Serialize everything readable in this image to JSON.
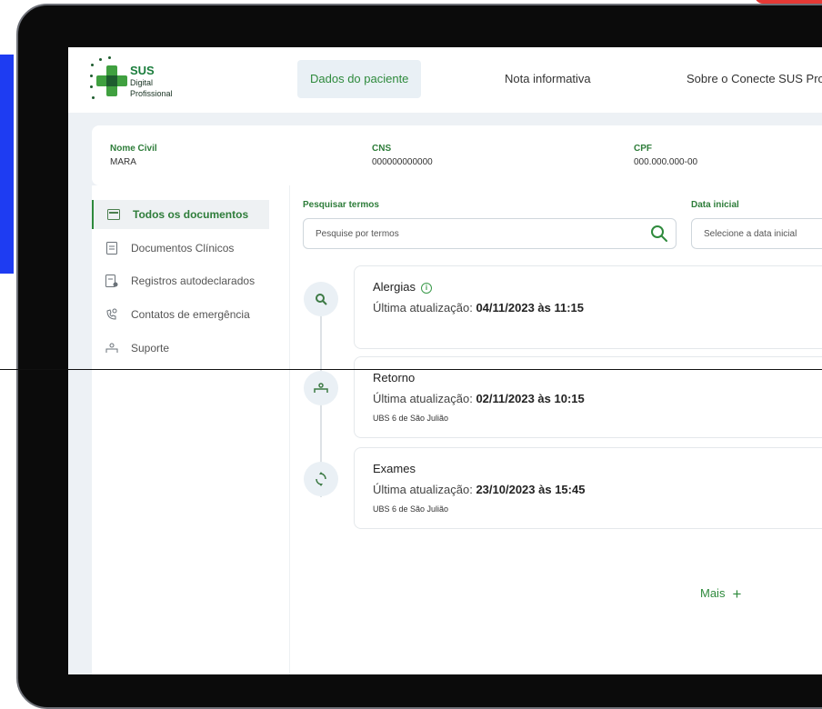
{
  "brand": {
    "line1": "SUS",
    "line2": "Digital",
    "line3": "Profissional",
    "primary_color": "#2e8a3c"
  },
  "nav": {
    "tabs": [
      {
        "label": "Dados do paciente",
        "active": true
      },
      {
        "label": "Nota informativa",
        "active": false
      },
      {
        "label": "Sobre o Conecte SUS Prof",
        "active": false
      }
    ]
  },
  "patient": {
    "nome_label": "Nome Civil",
    "nome_value": "MARA",
    "cns_label": "CNS",
    "cns_value": "000000000000",
    "cpf_label": "CPF",
    "cpf_value": "000.000.000-00"
  },
  "sidebar": {
    "items": [
      {
        "label": "Todos os documentos",
        "icon": "documents-icon",
        "active": true
      },
      {
        "label": "Documentos Clínicos",
        "icon": "clinical-document-icon",
        "active": false
      },
      {
        "label": "Registros autodeclarados",
        "icon": "self-declared-record-icon",
        "active": false
      },
      {
        "label": "Contatos de emergência",
        "icon": "emergency-phone-icon",
        "active": false
      },
      {
        "label": "Suporte",
        "icon": "support-icon",
        "active": false
      }
    ]
  },
  "filters": {
    "search_label": "Pesquisar termos",
    "search_placeholder": "Pesquise por termos",
    "date_label": "Data inicial",
    "date_placeholder": "Selecione a data inicial"
  },
  "timeline": [
    {
      "title": "Alergias",
      "info_prefix": "Última atualização: ",
      "date": "04/11/2023 às 11:15",
      "location": "",
      "icon": "search-icon",
      "has_info_icon": true
    },
    {
      "title": "Retorno",
      "info_prefix": "Última atualização: ",
      "date": "02/11/2023 às 10:15",
      "location": "UBS 6 de São Julião",
      "icon": "bed-icon",
      "has_info_icon": false
    },
    {
      "title": "Exames",
      "info_prefix": "Última atualização: ",
      "date": "23/10/2023 às 15:45",
      "location": "UBS 6 de São Julião",
      "icon": "recycle-icon",
      "has_info_icon": false
    }
  ],
  "more_label": "Mais",
  "more_icon": "plus-icon"
}
